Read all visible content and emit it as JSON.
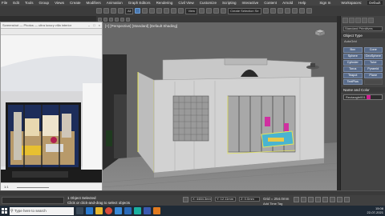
{
  "menu": [
    "File",
    "Edit",
    "Tools",
    "Group",
    "Views",
    "Create",
    "Modifiers",
    "Animation",
    "Graph Editors",
    "Rendering",
    "Civil View",
    "Customize",
    "Scripting",
    "Interactive",
    "Content",
    "Arnold",
    "Help"
  ],
  "window_title": "Sign In",
  "workspace_label": "Workspaces:",
  "workspace_value": "Default",
  "toolbar": {
    "selection_set": "Create Selection Se",
    "view_dropdown": "View",
    "ref_coord": "All"
  },
  "viewport": {
    "label": "[+] [Perspective] [Standard] [Default Shading]"
  },
  "photo_viewer": {
    "title": "Screenshot — Photos — ultra luxury villa interior",
    "zoom": "1:1"
  },
  "command_panel": {
    "category_dropdown": "Standard Primitives",
    "object_type_header": "Object Type",
    "autogrid": "AutoGrid",
    "buttons": [
      "Box",
      "Cone",
      "Sphere",
      "GeoSphere",
      "Cylinder",
      "Tube",
      "Torus",
      "Pyramid",
      "Teapot",
      "Plane",
      "TextPlus",
      ""
    ],
    "name_color_header": "Name and Color",
    "object_name": "Rectangle001"
  },
  "status": {
    "selection": "1 Object Selected",
    "hint": "Click or click-and-drag to select objects",
    "x": "X: 4484.3mm",
    "y": "Y: 12.11mm",
    "z": "Z: 0.0mm",
    "grid": "Grid = 254.0mm",
    "add_time_tag": "Add Time Tag"
  },
  "taskbar": {
    "search_placeholder": "Type here to search",
    "time": "15:08",
    "date": "22-07-2021"
  },
  "colors": {
    "selected_object": "#d02090",
    "viewport_bg": "#6a6a6a",
    "ui_dark": "#444444"
  }
}
